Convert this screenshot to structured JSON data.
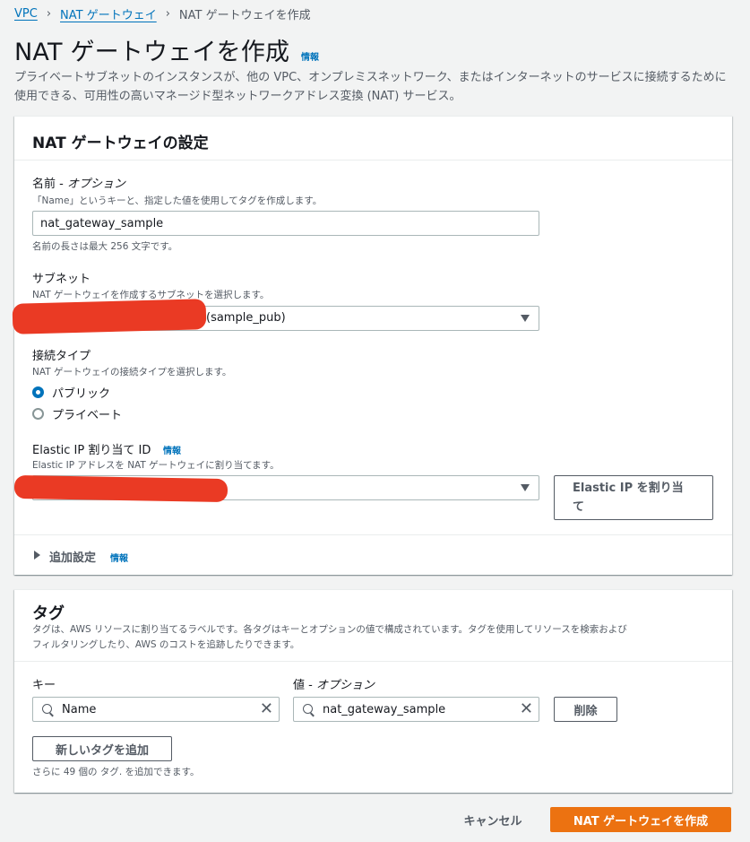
{
  "breadcrumb": {
    "items": [
      "VPC",
      "NAT ゲートウェイ"
    ],
    "current": "NAT ゲートウェイを作成"
  },
  "header": {
    "title": "NAT ゲートウェイを作成",
    "info": "情報",
    "description": "プライベートサブネットのインスタンスが、他の VPC、オンプレミスネットワーク、またはインターネットのサービスに接続するために使用できる、可用性の高いマネージド型ネットワークアドレス変換 (NAT) サービス。"
  },
  "settings": {
    "title": "NAT ゲートウェイの設定",
    "name": {
      "label": "名前 - ",
      "label_opt": "オプション",
      "desc": "「Name」というキーと、指定した値を使用してタグを作成します。",
      "value": "nat_gateway_sample",
      "hint": "名前の長さは最大 256 文字です。"
    },
    "subnet": {
      "label": "サブネット",
      "desc": "NAT ゲートウェイを作成するサブネットを選択します。",
      "value": "(sample_pub)"
    },
    "connectivity": {
      "label": "接続タイプ",
      "desc": "NAT ゲートウェイの接続タイプを選択します。",
      "options": [
        "パブリック",
        "プライベート"
      ],
      "selected": "パブリック"
    },
    "eip": {
      "label": "Elastic IP 割り当て ID",
      "info": "情報",
      "desc": "Elastic IP アドレスを NAT ゲートウェイに割り当てます。",
      "value": "",
      "allocate_button_line1": "Elastic IP を割り当",
      "allocate_button_line2": "て"
    },
    "additional": {
      "label": "追加設定",
      "info": "情報"
    }
  },
  "tags": {
    "title": "タグ",
    "desc_line1": "タグは、AWS リソースに割り当てるラベルです。各タグはキーとオプションの値で構成されています。タグを使用してリソースを検索および",
    "desc_line2": "フィルタリングしたり、AWS のコストを追跡したりできます。",
    "key_header": "キー",
    "value_header": "値 - ",
    "value_header_opt": "オプション",
    "rows": [
      {
        "key": "Name",
        "value": "nat_gateway_sample"
      }
    ],
    "remove_label": "削除",
    "add_label": "新しいタグを追加",
    "limit": "さらに 49 個の タグ. を追加できます。"
  },
  "footer": {
    "cancel": "キャンセル",
    "create": "NAT ゲートウェイを作成"
  },
  "colors": {
    "primary": "#ec7211",
    "link": "#0073bb",
    "redaction": "#ea3a24"
  },
  "icons": [
    "caret-down-icon",
    "search-icon",
    "clear-icon",
    "expand-triangle-icon"
  ]
}
